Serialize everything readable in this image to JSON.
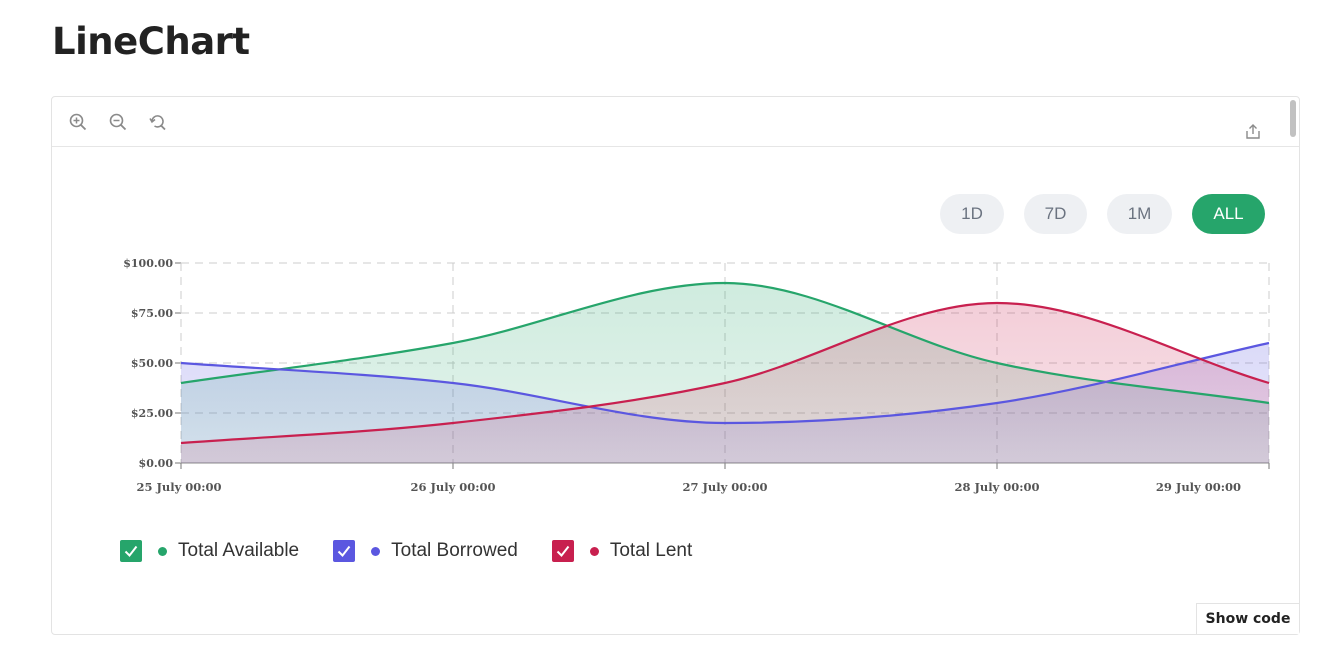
{
  "page": {
    "title": "LineChart"
  },
  "toolbar": {
    "icons": [
      "zoom-in-icon",
      "zoom-out-icon",
      "reset-zoom-icon",
      "export-icon"
    ]
  },
  "range_buttons": [
    {
      "label": "1D",
      "active": false
    },
    {
      "label": "7D",
      "active": false
    },
    {
      "label": "1M",
      "active": false
    },
    {
      "label": "ALL",
      "active": true
    }
  ],
  "colors": {
    "available": "#26a56b",
    "borrowed": "#5b57e0",
    "lent": "#c8204f",
    "grid": "#cccccc",
    "axis_text": "#555555"
  },
  "chart_data": {
    "type": "area",
    "x": [
      "25 July 00:00",
      "26 July 00:00",
      "27 July 00:00",
      "28 July 00:00",
      "29 July 00:00",
      "29 July 00:00"
    ],
    "x_ticks": [
      "25 July 00:00",
      "26 July 00:00",
      "27 July 00:00",
      "28 July 00:00",
      "29 July 00:00"
    ],
    "y_ticks": [
      "$0.00",
      "$25.00",
      "$50.00",
      "$75.00",
      "$100.00"
    ],
    "ylim": [
      0,
      100
    ],
    "grid": true,
    "legend_position": "bottom-left",
    "series": [
      {
        "name": "Total Available",
        "values": [
          40,
          60,
          90,
          50,
          30
        ],
        "color": "#26a56b"
      },
      {
        "name": "Total Borrowed",
        "values": [
          50,
          40,
          20,
          30,
          60
        ],
        "color": "#5b57e0"
      },
      {
        "name": "Total Lent",
        "values": [
          10,
          20,
          40,
          80,
          40
        ],
        "color": "#c8204f"
      }
    ]
  },
  "footer": {
    "show_code_label": "Show code"
  }
}
